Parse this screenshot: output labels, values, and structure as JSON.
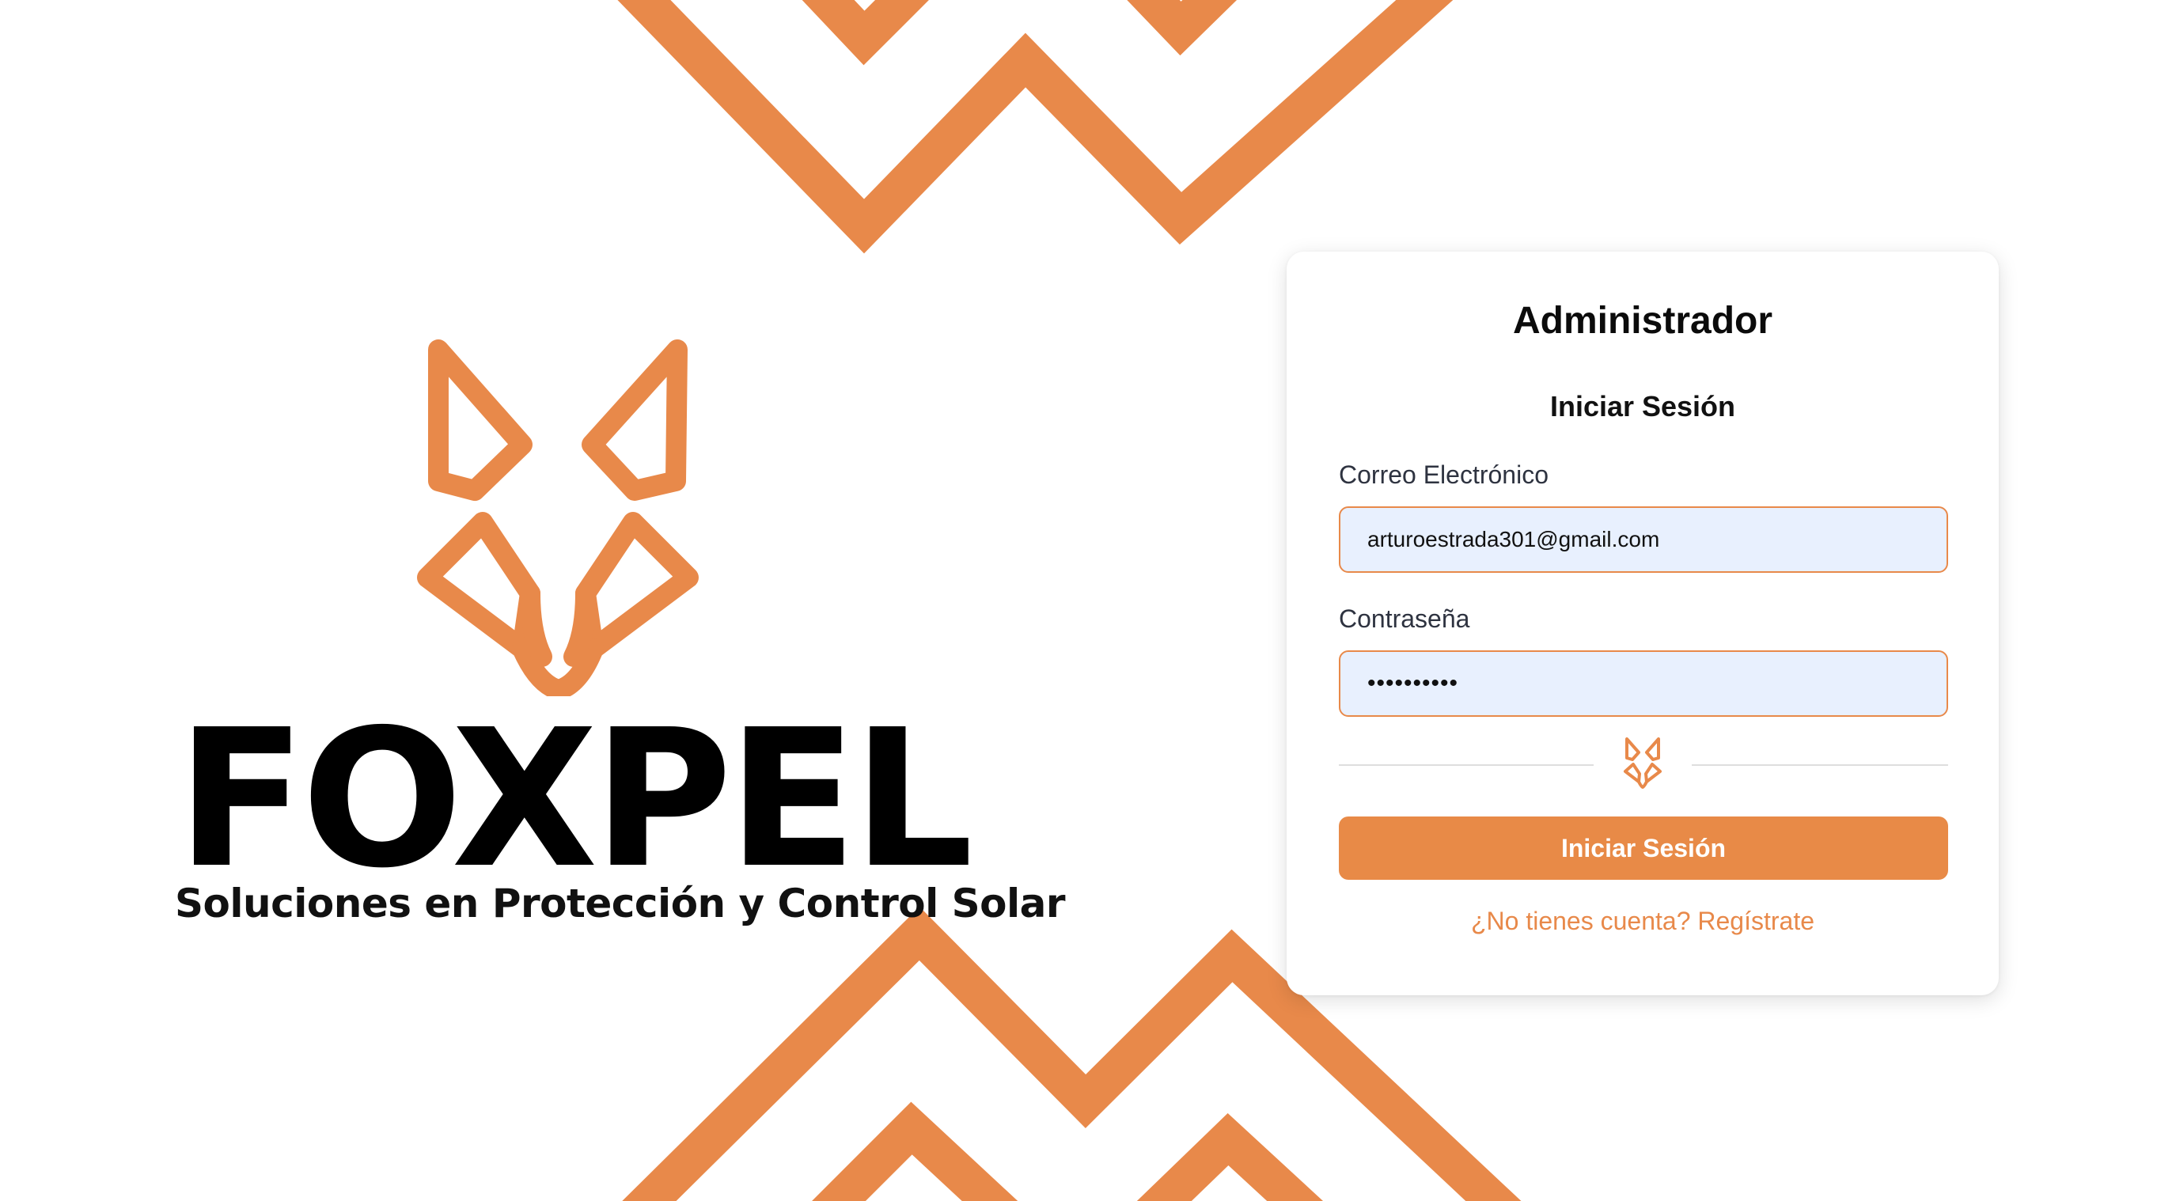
{
  "brand": {
    "name": "FOXPEL",
    "tagline": "Soluciones en Protección y Control Solar",
    "accent_color": "#e8894a"
  },
  "login": {
    "title": "Administrador",
    "subtitle": "Iniciar Sesión",
    "email": {
      "label": "Correo Electrónico",
      "value": "arturoestrada301@gmail.com"
    },
    "password": {
      "label": "Contraseña",
      "value": "••••••••••"
    },
    "divider_icon": "fox-head-icon",
    "submit_label": "Iniciar Sesión",
    "register_link": "¿No tienes cuenta? Regístrate"
  }
}
